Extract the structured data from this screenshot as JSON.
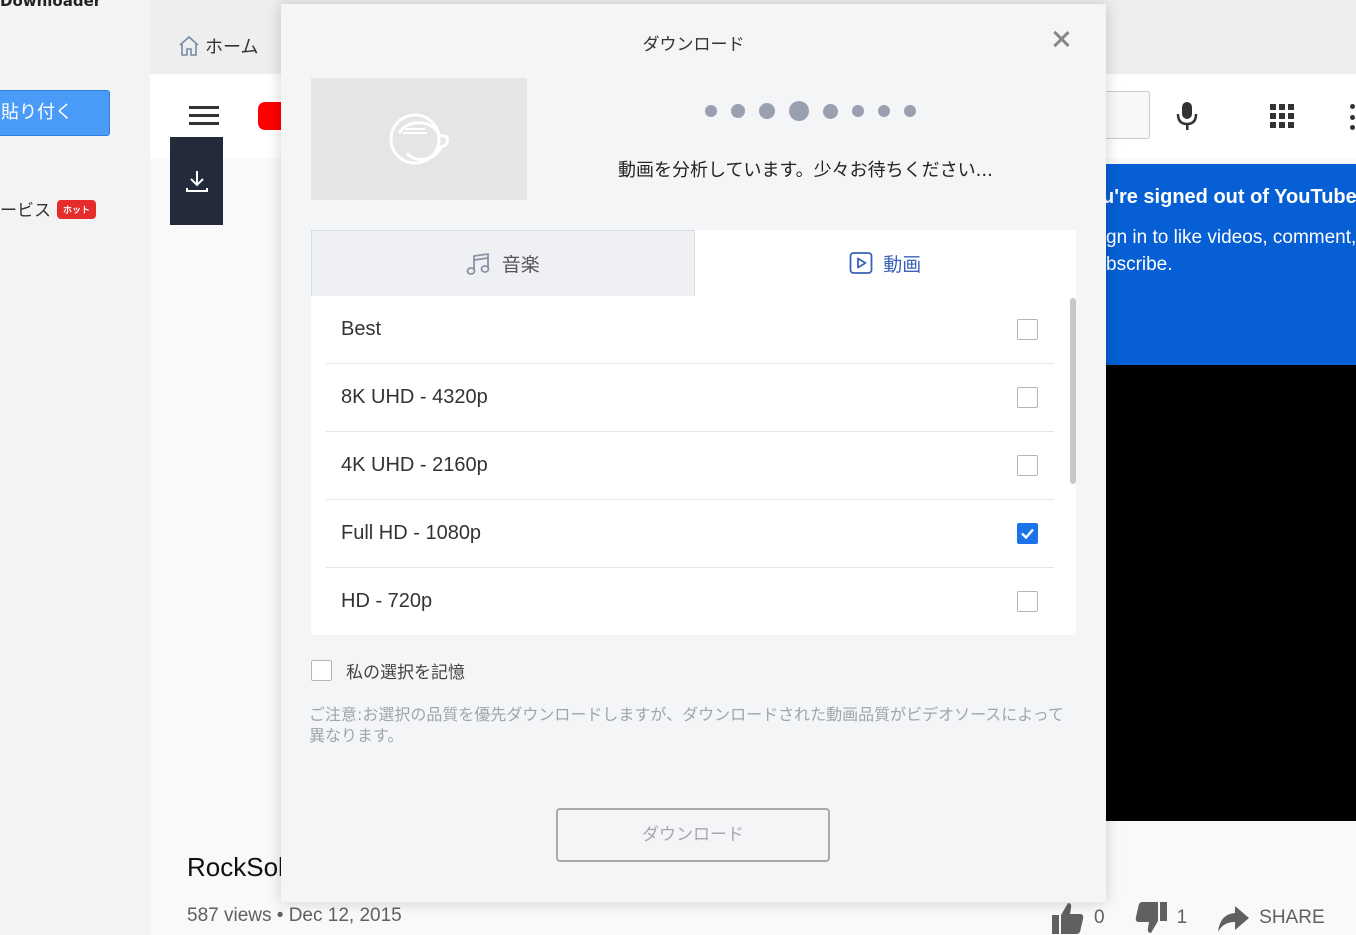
{
  "app": {
    "title": "Downloader",
    "sticky_button": "貼り付く",
    "service_item": "ービス",
    "hot_badge": "ホット",
    "breadcrumb_home": "ホーム"
  },
  "youtube": {
    "signed_out_title": "u're signed out of YouTube",
    "signed_out_text": "gn in to like videos, comment, bscribe.",
    "video_title": "RockSol",
    "video_meta": "587 views • Dec 12, 2015",
    "likes": "0",
    "dislikes": "1",
    "share_label": "SHARE"
  },
  "modal": {
    "title": "ダウンロード",
    "status": "動画を分析しています。少々お待ちください...",
    "tabs": [
      {
        "label": "音楽",
        "icon": "music-note-icon",
        "active": false
      },
      {
        "label": "動画",
        "icon": "video-play-icon",
        "active": true
      }
    ],
    "qualities": [
      {
        "label": "Best",
        "checked": false
      },
      {
        "label": "8K UHD - 4320p",
        "checked": false
      },
      {
        "label": "4K UHD - 2160p",
        "checked": false
      },
      {
        "label": "Full HD - 1080p",
        "checked": true
      },
      {
        "label": "HD - 720p",
        "checked": false
      }
    ],
    "remember_label": "私の選択を記憶",
    "notice": "ご注意:お選択の品質を優先ダウンロードしますが、ダウンロードされた動画品質がビデオソースによって異なります。",
    "download_button": "ダウンロード"
  },
  "colors": {
    "accent": "#1a73e8",
    "tab_active": "#3a62b8",
    "youtube_blue": "#065fd4",
    "sticky_button": "#4a9bf7"
  }
}
